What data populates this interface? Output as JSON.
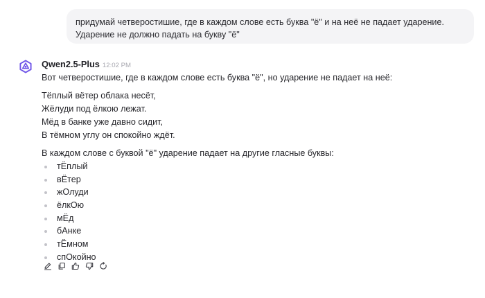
{
  "user_message": {
    "text": "придумай четверостишие, где в каждом слове есть буква \"ё\" и на неё не падает ударение. Ударение не должно падать на букву \"ё\""
  },
  "assistant": {
    "model_name": "Qwen2.5-Plus",
    "timestamp": "12:02 PM",
    "avatar_icon": "qwen-logo-icon",
    "intro": "Вот четверостишие, где в каждом слове есть буква \"ё\", но ударение не падает на неё:",
    "poem": [
      "Тёплый вётер облака несёт,",
      "Жёлуди под ёлкою лежат.",
      "Мёд в банке уже давно сидит,",
      "В тёмном углу он спокойно ждёт."
    ],
    "explanation": "В каждом слове с буквой \"ё\" ударение падает на другие гласные буквы:",
    "words": [
      "тЁплый",
      "вЁтер",
      "жОлуди",
      "ёлкОю",
      "мЁд",
      "бАнке",
      "тЁмном",
      "спОкойно"
    ]
  },
  "actions": [
    {
      "name": "edit-icon"
    },
    {
      "name": "copy-icon"
    },
    {
      "name": "thumbs-up-icon"
    },
    {
      "name": "thumbs-down-icon"
    },
    {
      "name": "regenerate-icon"
    }
  ],
  "colors": {
    "user_bubble_bg": "#f4f4f6",
    "logo_purple": "#6f55e8",
    "muted_text": "#a8a8b0"
  }
}
